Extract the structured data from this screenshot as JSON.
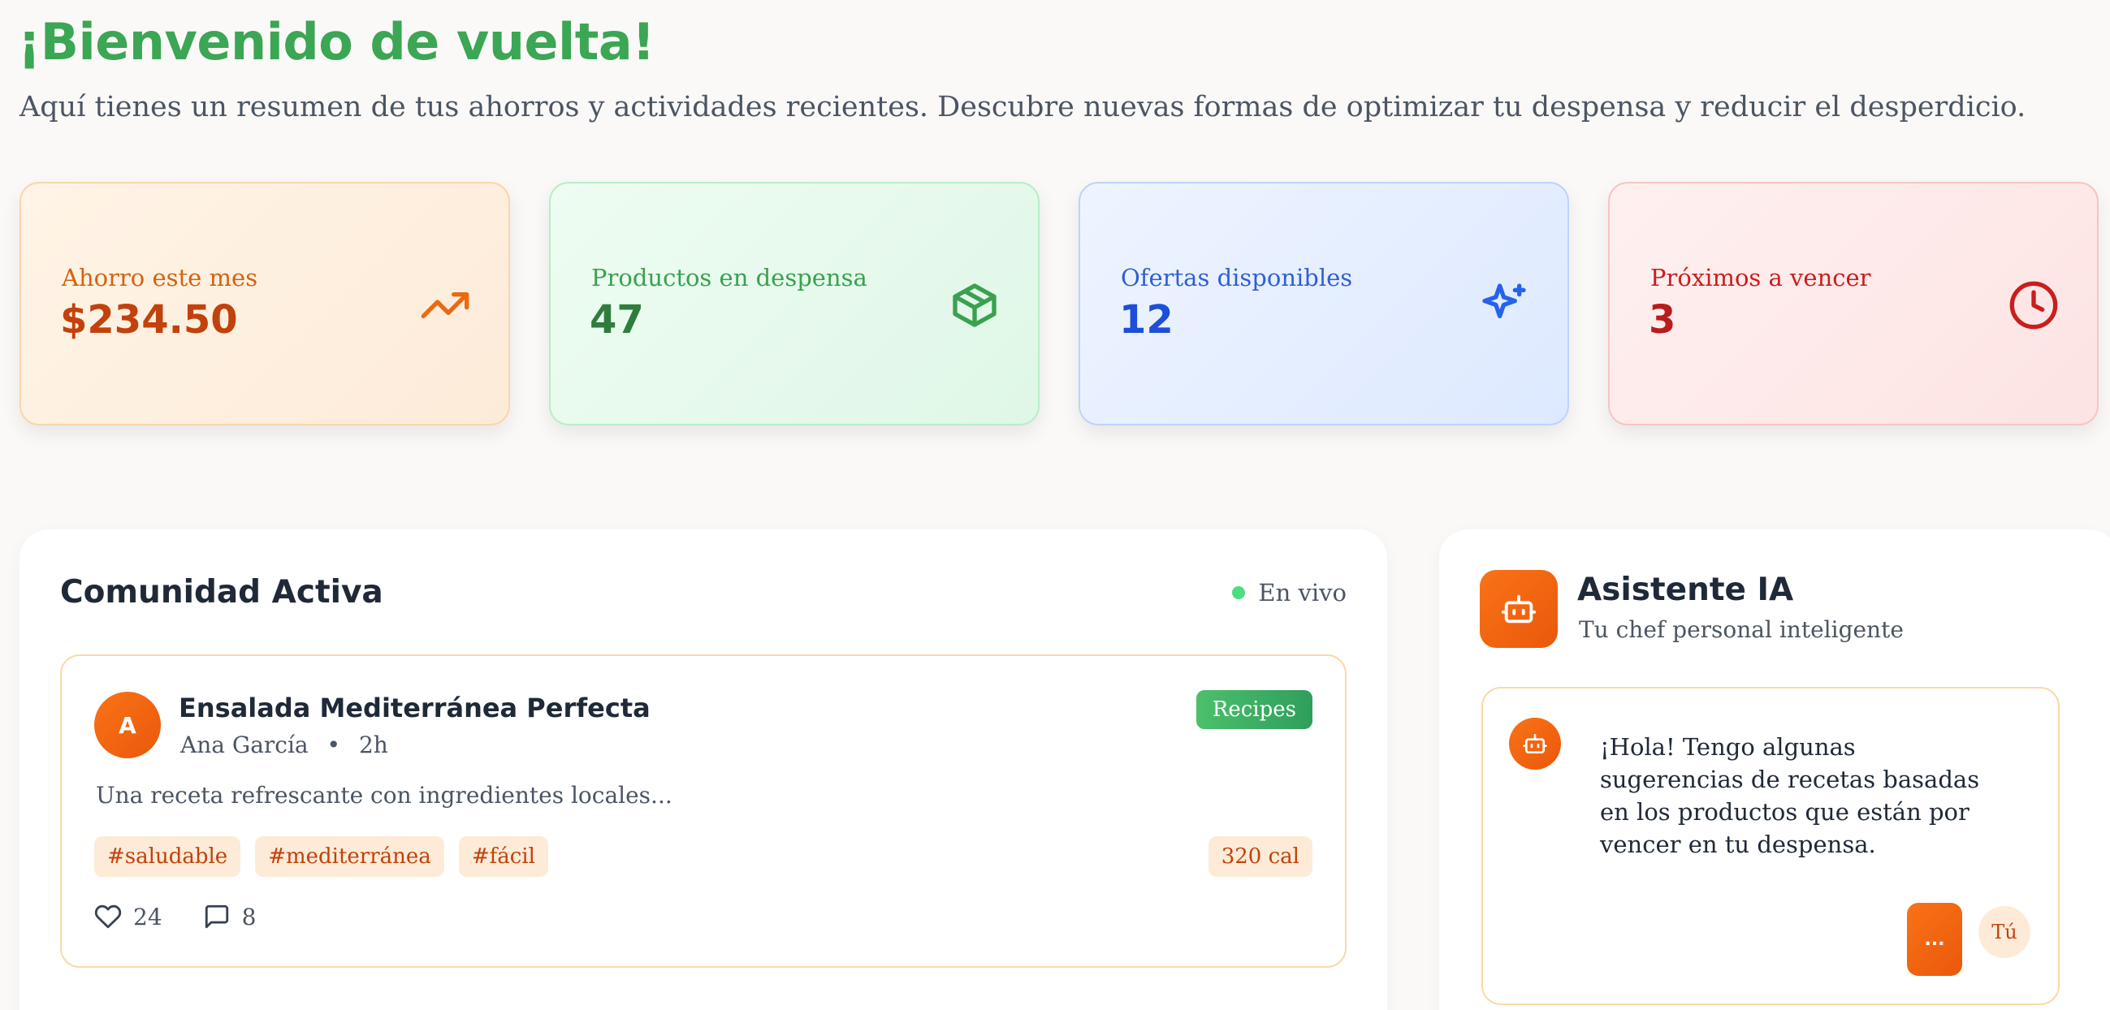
{
  "header": {
    "title": "¡Bienvenido de vuelta!",
    "subtitle": "Aquí tienes un resumen de tus ahorros y actividades recientes. Descubre nuevas formas de optimizar tu despensa y reducir el desperdicio."
  },
  "stats": [
    {
      "label": "Ahorro este mes",
      "value": "$234.50",
      "icon": "trending-up-icon",
      "color": "#ea6a12"
    },
    {
      "label": "Productos en despensa",
      "value": "47",
      "icon": "package-icon",
      "color": "#3aa14e"
    },
    {
      "label": "Ofertas disponibles",
      "value": "12",
      "icon": "sparkles-icon",
      "color": "#2563eb"
    },
    {
      "label": "Próximos a vencer",
      "value": "3",
      "icon": "clock-icon",
      "color": "#c81e1e"
    }
  ],
  "community": {
    "title": "Comunidad Activa",
    "live_label": "En vivo",
    "post": {
      "avatar_initial": "A",
      "title": "Ensalada Mediterránea Perfecta",
      "author": "Ana García",
      "separator": "•",
      "time": "2h",
      "category": "Recipes",
      "description": "Una receta refrescante con ingredientes locales...",
      "tags": [
        "#saludable",
        "#mediterránea",
        "#fácil"
      ],
      "calories": "320 cal",
      "likes": "24",
      "comments": "8"
    }
  },
  "assistant": {
    "title": "Asistente IA",
    "subtitle": "Tu chef personal inteligente",
    "message": "¡Hola! Tengo algunas sugerencias de recetas basadas en los productos que están por vencer en tu despensa.",
    "typing_label": "...",
    "user_label": "Tú"
  },
  "colors": {
    "brand_green": "#3ba654",
    "brand_orange": "#f97316",
    "background": "#faf9f7"
  }
}
